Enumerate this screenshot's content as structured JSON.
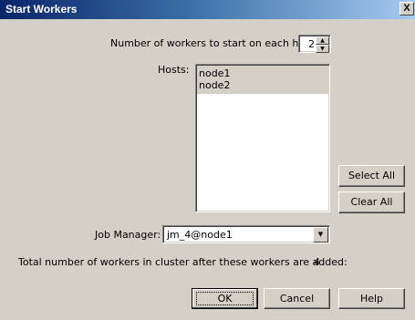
{
  "window": {
    "title": "Start Workers",
    "close_glyph": "X"
  },
  "workers": {
    "label": "Number of workers to start on each host:",
    "value": "2"
  },
  "hosts": {
    "label": "Hosts:",
    "items": [
      "node1",
      "node2"
    ]
  },
  "buttons": {
    "select_all": "Select All",
    "clear_all": "Clear All",
    "ok": "OK",
    "cancel": "Cancel",
    "help": "Help"
  },
  "job_manager": {
    "label": "Job Manager:",
    "value": "jm_4@node1"
  },
  "total": {
    "text": "Total number of workers in cluster after these workers are added:",
    "value": "4"
  },
  "icons": {
    "spin_up": "spin-up-icon",
    "spin_down": "spin-down-icon",
    "dropdown": "chevron-down-icon",
    "close": "close-icon"
  }
}
